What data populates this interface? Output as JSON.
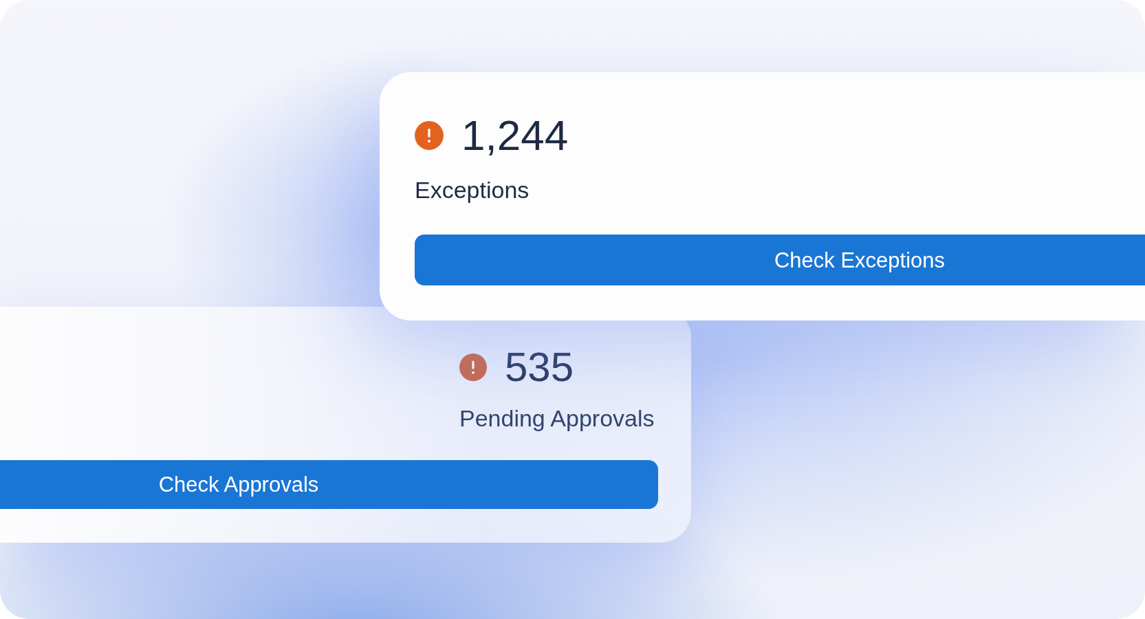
{
  "exceptions_card": {
    "count": "1,244",
    "label": "Exceptions",
    "button": "Check Exceptions"
  },
  "approvals_card": {
    "count": "535",
    "label": "Pending Approvals",
    "button": "Check Approvals"
  }
}
